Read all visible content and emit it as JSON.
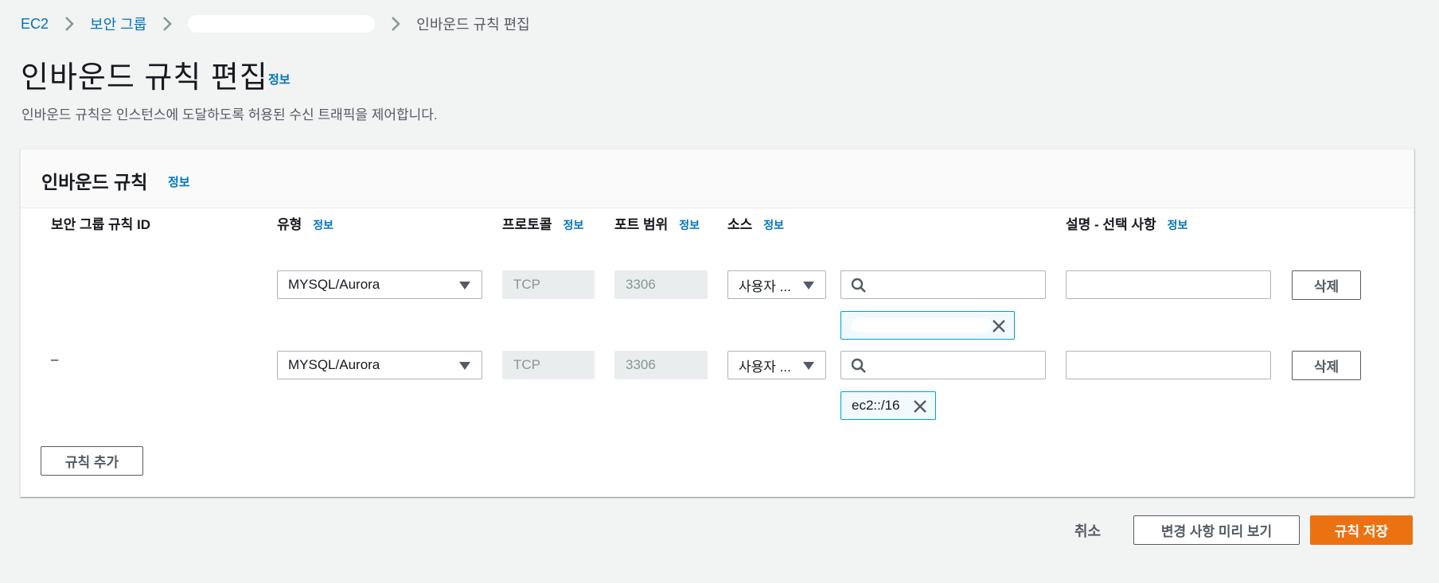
{
  "breadcrumb": {
    "items": [
      "EC2",
      "보안 그룹",
      "인바운드 규칙 편집"
    ]
  },
  "page": {
    "title": "인바운드 규칙 편집",
    "info": "정보",
    "description": "인바운드 규칙은 인스턴스에 도달하도록 허용된 수신 트래픽을 제어합니다."
  },
  "panel": {
    "title": "인바운드 규칙",
    "info": "정보",
    "columns": {
      "rule_id": "보안 그룹 규칙 ID",
      "type": "유형",
      "protocol": "프로토콜",
      "port_range": "포트 범위",
      "source": "소스",
      "description": "설명 - 선택 사항",
      "info": "정보"
    },
    "rows": [
      {
        "rule_id": "",
        "type": "MYSQL/Aurora",
        "protocol": "TCP",
        "port": "3306",
        "source_type": "사용자 ...",
        "search_value": "",
        "token": "",
        "description_value": "",
        "delete": "삭제"
      },
      {
        "rule_id": "–",
        "type": "MYSQL/Aurora",
        "protocol": "TCP",
        "port": "3306",
        "source_type": "사용자 ...",
        "search_value": "",
        "token": "ec2::/16",
        "description_value": "",
        "delete": "삭제"
      }
    ],
    "add_rule": "규칙 추가"
  },
  "footer": {
    "cancel": "취소",
    "preview": "변경 사항 미리 보기",
    "save": "규칙 저장"
  },
  "colors": {
    "link": "#0073bb",
    "primary_button": "#ec7211",
    "token_border": "#00a1c9",
    "background": "#f2f3f3"
  },
  "icons": [
    "chevron-right-icon",
    "search-icon",
    "close-icon",
    "caret-down-icon"
  ]
}
